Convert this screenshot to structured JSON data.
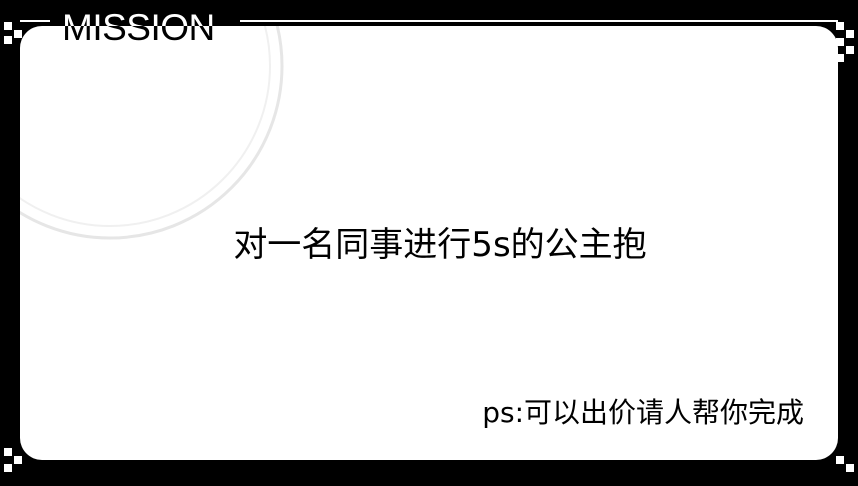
{
  "mission_card": {
    "heading": "MISSION",
    "task": "对一名同事进行5s的公主抱",
    "note": "ps:可以出价请人帮你完成"
  },
  "colors": {
    "background": "#000000",
    "card": "#ffffff",
    "text": "#000000",
    "deco_ring": "#e6e6e6"
  },
  "icons": {
    "corner_pattern": "checker-squares-icon",
    "ring_decoration": "concentric-ring-icon"
  }
}
